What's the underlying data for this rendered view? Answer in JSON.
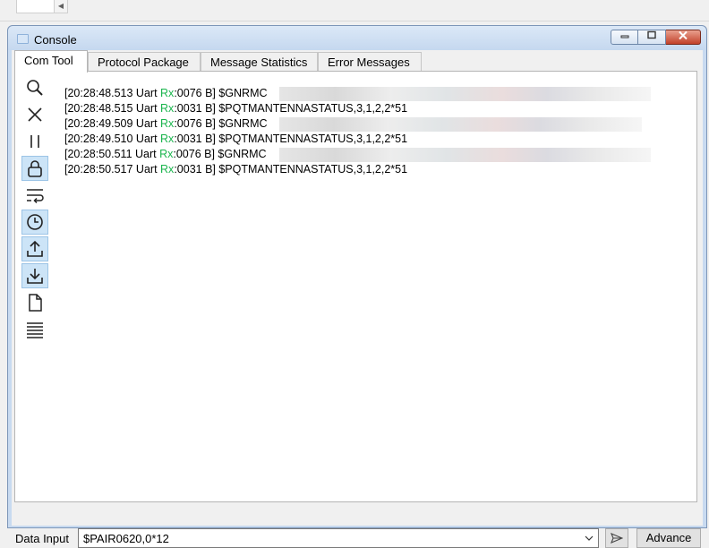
{
  "window": {
    "title": "Console"
  },
  "tabs": [
    {
      "label": "Com Tool",
      "active": true
    },
    {
      "label": "Protocol Package",
      "active": false
    },
    {
      "label": "Message Statistics",
      "active": false
    },
    {
      "label": "Error Messages",
      "active": false
    }
  ],
  "toolbar": [
    {
      "name": "search-icon",
      "toggled": false
    },
    {
      "name": "clear-icon",
      "toggled": false
    },
    {
      "name": "pause-icon",
      "toggled": false
    },
    {
      "name": "lock-icon",
      "toggled": true
    },
    {
      "name": "word-wrap-icon",
      "toggled": false
    },
    {
      "name": "clock-icon",
      "toggled": true
    },
    {
      "name": "upload-icon",
      "toggled": true
    },
    {
      "name": "download-icon",
      "toggled": true
    },
    {
      "name": "file-icon",
      "toggled": false
    },
    {
      "name": "list-icon",
      "toggled": false
    }
  ],
  "log": [
    {
      "pre": "[20:28:48.513 Uart ",
      "rx": "Rx",
      "post": ":0076 B] $GNRMC"
    },
    {
      "pre": "[20:28:48.515 Uart ",
      "rx": "Rx",
      "post": ":0031 B] $PQTMANTENNASTATUS,3,1,2,2*51"
    },
    {
      "pre": "[20:28:49.509 Uart ",
      "rx": "Rx",
      "post": ":0076 B] $GNRMC"
    },
    {
      "pre": "[20:28:49.510 Uart ",
      "rx": "Rx",
      "post": ":0031 B] $PQTMANTENNASTATUS,3,1,2,2*51"
    },
    {
      "pre": "[20:28:50.511 Uart ",
      "rx": "Rx",
      "post": ":0076 B] $GNRMC"
    },
    {
      "pre": "[20:28:50.517 Uart ",
      "rx": "Rx",
      "post": ":0031 B] $PQTMANTENNASTATUS,3,1,2,2*51"
    }
  ],
  "data_input": {
    "label": "Data Input",
    "value": "$PAIR0620,0*12"
  },
  "buttons": {
    "advance": "Advance"
  },
  "colors": {
    "rx": "#1ab54d",
    "toggled": "#cce4f7"
  }
}
